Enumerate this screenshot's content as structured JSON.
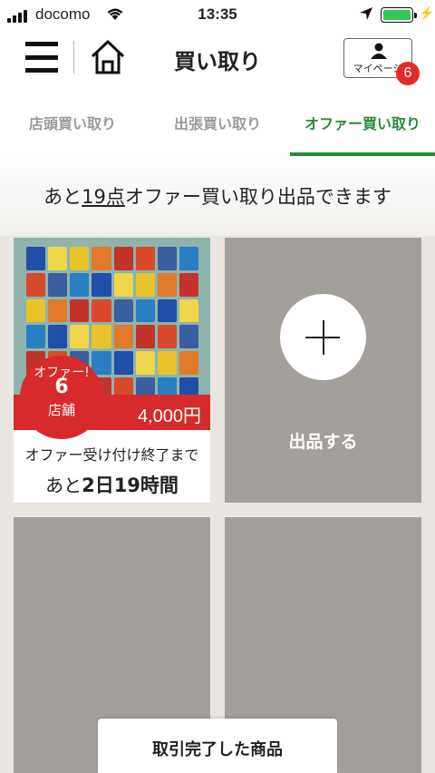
{
  "status_bar": {
    "carrier": "docomo",
    "time": "13:35",
    "battery_level": 1.0
  },
  "header": {
    "title": "買い取り",
    "mypage_label": "マイページ",
    "notification_count": "6"
  },
  "tabs": [
    {
      "label": "店頭買い取り",
      "active": false
    },
    {
      "label": "出張買い取り",
      "active": false
    },
    {
      "label": "オファー買い取り",
      "active": true
    }
  ],
  "notice": {
    "prefix": "あと",
    "count": "19点",
    "suffix": "オファー買い取り出品できます"
  },
  "listings": [
    {
      "offer_label": "オファー!",
      "offer_count": "6",
      "offer_unit": "店舗",
      "price": "4,000円",
      "deadline_label": "オファー受け付け終了まで",
      "remaining_prefix": "あと",
      "remaining_time": "2日19時間"
    }
  ],
  "add_card": {
    "label": "出品する"
  },
  "bottom_button": {
    "label": "取引完了した商品"
  },
  "colors": {
    "accent_green": "#2a8a3a",
    "offer_red": "#d72a2a",
    "badge_red": "#e32b2b",
    "placeholder_gray": "#a3a09c"
  }
}
